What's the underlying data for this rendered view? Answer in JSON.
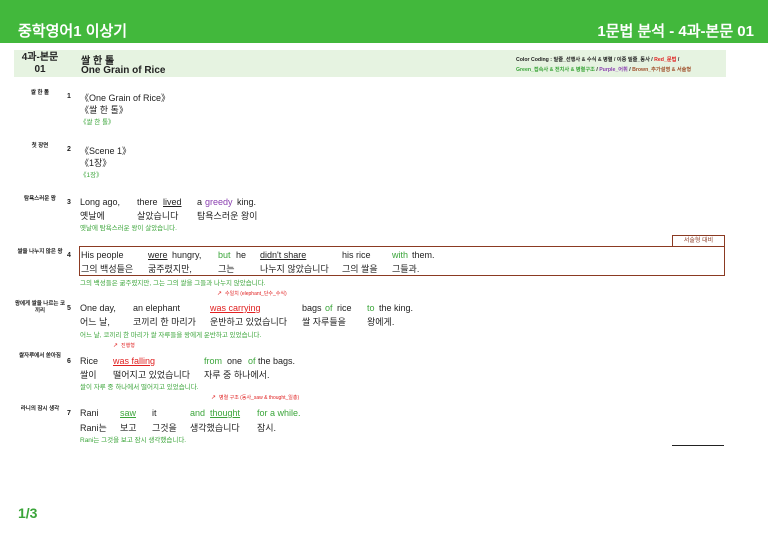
{
  "header": {
    "title_left": "중학영어1 이상기",
    "title_right": "1문법 분석 - 4과-본문 01"
  },
  "lesson": {
    "code_line1": "4과-본문",
    "code_line2": "01",
    "kor_title": "쌀 한 톨",
    "eng_title": "One Grain of Rice"
  },
  "legend": {
    "line1_black": "Color Coding : 밑줄_선행사 & 수식 & 병렬 / 이중 밑줄_동사 / ",
    "line1_red": "Red_문법",
    "line1_tail": " /",
    "line2_green": "Green_접속사 & 전치사 & 병렬구조",
    "line2_sep1": " / ",
    "line2_purple": "Purple_어휘",
    "line2_sep2": " / ",
    "line2_brown": "Brown_추가설명 & 서술형"
  },
  "sentences": [
    {
      "num": "1",
      "label": "쌀 한 톨",
      "eng": "《One Grain of Rice》",
      "kor": "《쌀 한 톨》",
      "trans": "《쌀 한 톨》"
    },
    {
      "num": "2",
      "label": "첫 장면",
      "eng": "《Scene 1》",
      "kor": "《1장》",
      "trans": "《1장》"
    },
    {
      "num": "3",
      "label": "탐욕스러운 왕",
      "eng_words": [
        "Long ago,",
        "there",
        "lived",
        "a",
        "greedy",
        "king."
      ],
      "kor_words": [
        "옛날에",
        "살았습니다",
        "탐욕스러운 왕이"
      ],
      "trans": "옛날에 탐욕스러운 왕이 살았습니다."
    },
    {
      "num": "4",
      "label": "쌀을 나누지 않은 왕",
      "eng_words": [
        "His people",
        "were",
        "hungry,",
        "but",
        "he",
        "didn't share",
        "his rice",
        "with",
        "them."
      ],
      "kor_words": [
        "그의 백성들은",
        "굶주렸지만,",
        "그는",
        "나누지 않았습니다",
        "그의 쌀을",
        "그들과."
      ],
      "trans": "그의 백성들은 굶주렸지만, 그는 그의 쌀을 그들과 나누지 않았습니다.",
      "badge": "서술형 대비"
    },
    {
      "num": "5",
      "label": "왕에게 쌀을 나르는 코끼리",
      "eng_words": [
        "One day,",
        "an elephant",
        "was carrying",
        "bags",
        "of",
        "rice",
        "to",
        "the king."
      ],
      "kor_words": [
        "어느 날,",
        "코끼리 한 마리가",
        "운반하고 있었습니다",
        "쌀 자루들을",
        "왕에게."
      ],
      "trans": "어느 날, 코끼리 한 마리가 쌀 자루들을 왕에게 운반하고 있었습니다.",
      "note": "수일치 (elephant_단수_수식)"
    },
    {
      "num": "6",
      "label": "쌀자루에서 쏟아짐",
      "eng_words": [
        "Rice",
        "was falling",
        "from",
        "one",
        "of",
        "the bags."
      ],
      "kor_words": [
        "쌀이",
        "떨어지고 있었습니다",
        "자루 중 하나에서."
      ],
      "trans": "쌀이 자루 중 하나에서 떨어지고 있었습니다.",
      "note": "진행형"
    },
    {
      "num": "7",
      "label": "라니의 잠시 생각",
      "eng_words": [
        "Rani",
        "saw",
        "it",
        "and",
        "thought",
        "for a while."
      ],
      "kor_words": [
        "Rani는",
        "보고",
        "그것을",
        "생각했습니다",
        "잠시."
      ],
      "trans": "Rani는 그것을 보고 잠시 생각했습니다.",
      "note": "병렬 구조 (동사_saw & thought_일총)"
    }
  ],
  "footer": {
    "page": "1/3"
  }
}
